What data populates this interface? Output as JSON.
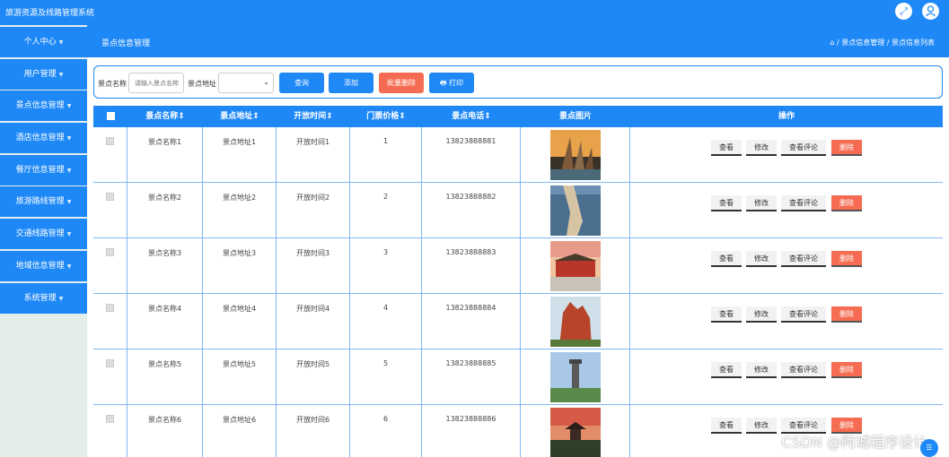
{
  "app": {
    "title": "旅游资源及线路管理系统"
  },
  "topbar": {
    "fullscreen_icon": "expand-icon",
    "user_icon": "user-icon"
  },
  "sidebar": {
    "items": [
      {
        "label": "个人中心",
        "has_chevron": true
      },
      {
        "label": "用户管理",
        "has_chevron": true
      },
      {
        "label": "景点信息管理",
        "has_chevron": true
      },
      {
        "label": "酒店信息管理",
        "has_chevron": true
      },
      {
        "label": "餐厅信息管理",
        "has_chevron": true
      },
      {
        "label": "旅游路线管理",
        "has_chevron": true
      },
      {
        "label": "交通线路管理",
        "has_chevron": true
      },
      {
        "label": "地域信息管理",
        "has_chevron": true
      },
      {
        "label": "系统管理",
        "has_chevron": true
      }
    ]
  },
  "header": {
    "page_title": "景点信息管理",
    "breadcrumb": "⌂ / 景点信息管理 / 景点信息列表"
  },
  "search": {
    "name_label": "景点名称",
    "name_placeholder": "请输入景点名称",
    "address_label": "景点地址",
    "address_value": "",
    "query_label": "查询",
    "add_label": "添加",
    "batch_delete_label": "批量删除",
    "print_label": "🖶 打印"
  },
  "table": {
    "headers": [
      "景点名称⇕",
      "景点地址⇕",
      "开放时间⇕",
      "门票价格⇕",
      "景点电话⇕",
      "景点图片",
      "操作"
    ],
    "actions": {
      "view": "查看",
      "edit": "修改",
      "comments": "查看评论",
      "delete": "删除"
    },
    "rows": [
      {
        "name": "景点名称1",
        "address": "景点地址1",
        "open_time": "开放时间1",
        "price": "1",
        "phone": "13823888881",
        "image": "sail-buildings-photo"
      },
      {
        "name": "景点名称2",
        "address": "景点地址2",
        "open_time": "开放时间2",
        "price": "2",
        "phone": "13823888882",
        "image": "coastal-rock-photo"
      },
      {
        "name": "景点名称3",
        "address": "景点地址3",
        "open_time": "开放时间3",
        "price": "3",
        "phone": "13823888883",
        "image": "tiananmen-photo"
      },
      {
        "name": "景点名称4",
        "address": "景点地址4",
        "open_time": "开放时间4",
        "price": "4",
        "phone": "13823888884",
        "image": "red-rock-photo"
      },
      {
        "name": "景点名称5",
        "address": "景点地址5",
        "open_time": "开放时间5",
        "price": "5",
        "phone": "13823888885",
        "image": "tower-monument-photo"
      },
      {
        "name": "景点名称6",
        "address": "景点地址6",
        "open_time": "开放时间6",
        "price": "6",
        "phone": "13823888886",
        "image": "pagoda-photo"
      }
    ]
  },
  "watermark": "CSDN @阿城程序设计",
  "colors": {
    "primary": "#1e88f7",
    "danger": "#f56c52",
    "sidebar_bg": "#e3eeea",
    "grid": "#7fb8f2"
  }
}
